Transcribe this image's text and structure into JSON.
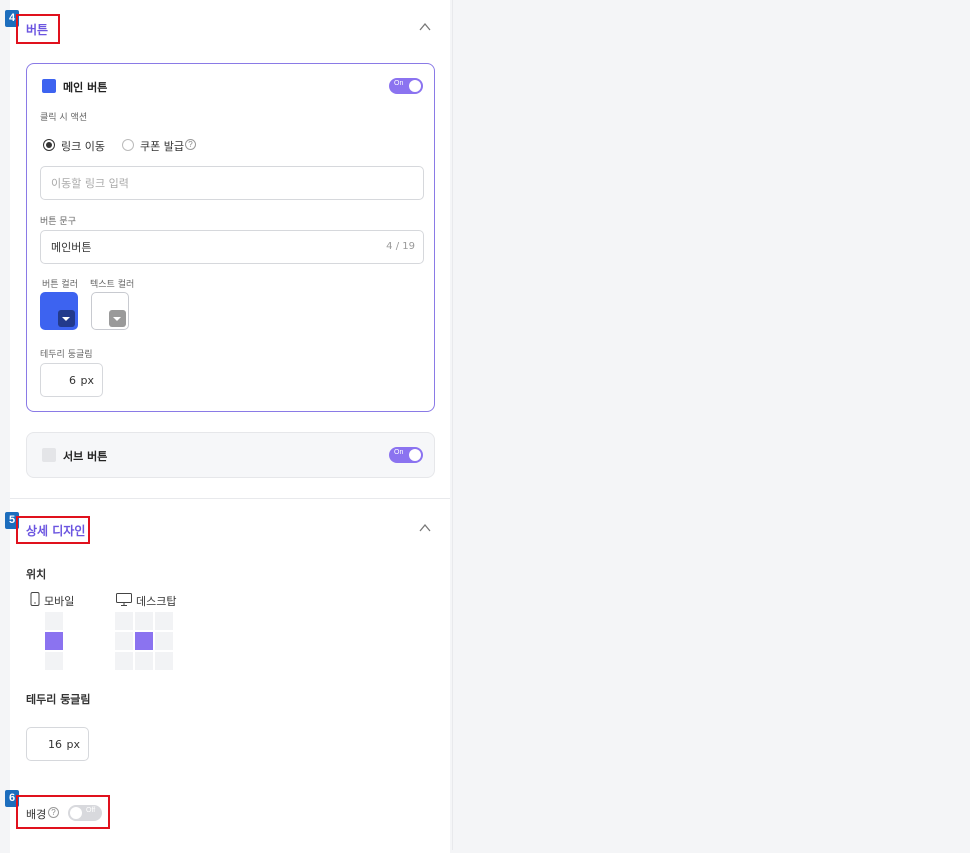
{
  "section_button": {
    "badge": "4",
    "title": "버튼",
    "main_button": {
      "title": "메인 버튼",
      "toggle_label": "On",
      "click_action_label": "클릭 시 액션",
      "radio_link": "링크 이동",
      "radio_coupon": "쿠폰 발급",
      "help_mark": "?",
      "link_placeholder": "이동할 링크 입력",
      "text_label": "버튼 문구",
      "text_value": "메인버튼",
      "text_counter": "4 / 19",
      "button_color_label": "버튼 컬러",
      "text_color_label": "텍스트 컬러",
      "radius_label": "테두리 둥글림",
      "radius_value": "6",
      "radius_unit": "px"
    },
    "sub_button": {
      "title": "서브 버튼",
      "toggle_label": "On"
    }
  },
  "section_detail": {
    "badge": "5",
    "title": "상세 디자인",
    "position_label": "위치",
    "mobile_label": "모바일",
    "desktop_label": "데스크탑",
    "radius_label": "테두리 둥글림",
    "radius_value": "16",
    "radius_unit": "px"
  },
  "section_background": {
    "badge": "6",
    "label": "배경",
    "help_mark": "?",
    "toggle_label": "Off"
  },
  "colors": {
    "accent": "#6b55e0",
    "toggle_on": "#8b73f0",
    "button_color": "#3d63f0",
    "button_color_dropdown": "#233a8c",
    "text_color": "#ffffff",
    "text_color_dropdown": "#9a9a9a"
  }
}
